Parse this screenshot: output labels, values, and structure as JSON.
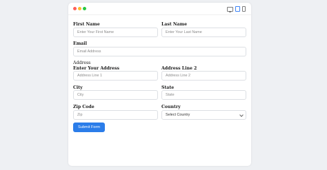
{
  "colors": {
    "accent": "#2b7de9",
    "dot_red": "#ff5f57",
    "dot_yellow": "#febc2e",
    "dot_green": "#28c840"
  },
  "toolbar": {
    "icons": [
      "desktop-icon",
      "tablet-icon",
      "mobile-icon"
    ]
  },
  "form": {
    "first_name": {
      "label": "First Name",
      "placeholder": "Enter Your First Name"
    },
    "last_name": {
      "label": "Last Name",
      "placeholder": "Enter Your Last Name"
    },
    "email": {
      "label": "Email",
      "placeholder": "Email Address"
    },
    "address_heading": "Address",
    "address1": {
      "label": "Enter Your Address",
      "placeholder": "Address Line 1"
    },
    "address2": {
      "label": "Address Line 2",
      "placeholder": "Address Line 2"
    },
    "city": {
      "label": "City",
      "placeholder": "City"
    },
    "state": {
      "label": "State",
      "placeholder": "State"
    },
    "zip": {
      "label": "Zip Code",
      "placeholder": "Zip"
    },
    "country": {
      "label": "Country",
      "selected": "Select Country"
    },
    "submit_label": "Submit Form"
  }
}
